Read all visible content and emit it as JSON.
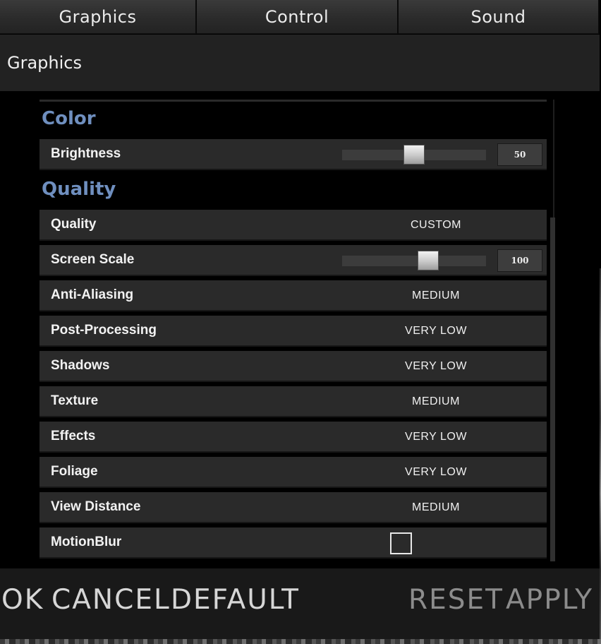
{
  "tabs": [
    {
      "label": "Graphics"
    },
    {
      "label": "Control"
    },
    {
      "label": "Sound"
    }
  ],
  "header": {
    "title": "Graphics"
  },
  "groups": {
    "color": {
      "title": "Color",
      "brightness": {
        "label": "Brightness",
        "value": "50",
        "level": 0.5
      }
    },
    "quality": {
      "title": "Quality",
      "preset": {
        "label": "Quality",
        "value": "CUSTOM"
      },
      "screen_scale": {
        "label": "Screen Scale",
        "value": "100",
        "level": 0.6
      },
      "anti_aliasing": {
        "label": "Anti-Aliasing",
        "value": "MEDIUM"
      },
      "post_processing": {
        "label": "Post-Processing",
        "value": "VERY LOW"
      },
      "shadows": {
        "label": "Shadows",
        "value": "VERY LOW"
      },
      "texture": {
        "label": "Texture",
        "value": "MEDIUM"
      },
      "effects": {
        "label": "Effects",
        "value": "VERY LOW"
      },
      "foliage": {
        "label": "Foliage",
        "value": "VERY LOW"
      },
      "view_distance": {
        "label": "View Distance",
        "value": "MEDIUM"
      },
      "motion_blur": {
        "label": "MotionBlur",
        "checked": false
      }
    }
  },
  "footer": {
    "ok": "OK",
    "cancel": "CANCEL",
    "default": "DEFAULT",
    "reset": "RESET",
    "apply": "APPLY"
  },
  "colors": {
    "group_title": "#6f8fbf",
    "row_bg": "#2a2a2a",
    "footer_bg": "#191919"
  }
}
